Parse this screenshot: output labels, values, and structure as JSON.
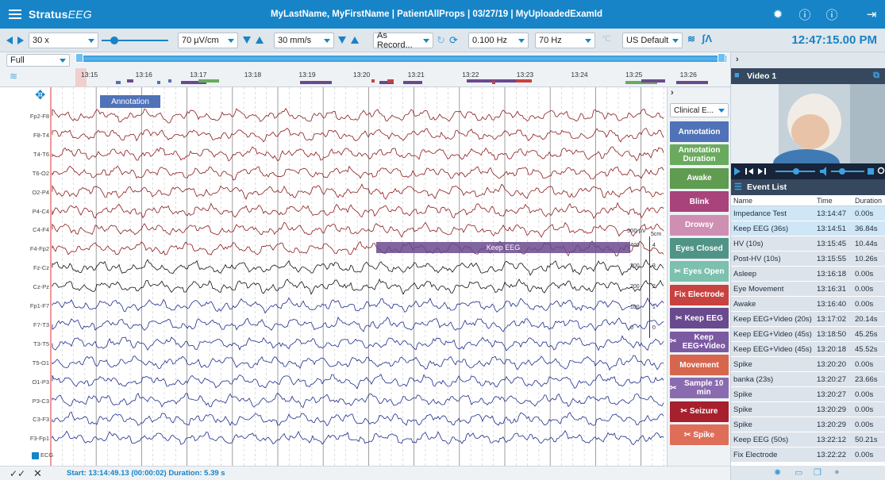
{
  "header": {
    "logo_main": "Stratus",
    "logo_accent": "EEG",
    "patient_title": "MyLastName, MyFirstName | PatientAllProps  | 03/27/19 | MyUploadedExamId"
  },
  "toolbar": {
    "speed": "30 x",
    "sensitivity": "70 µV/cm",
    "timebase": "30 mm/s",
    "montage": "As Record...",
    "low_filter": "0.100 Hz",
    "high_filter": "70 Hz",
    "notch_icon": "notch-filter-icon",
    "region": "US Default",
    "clock": "12:47:15.00 PM"
  },
  "view": {
    "mode": "Full",
    "time_ticks": [
      "13:15",
      "13:16",
      "13:17",
      "13:18",
      "13:19",
      "13:20",
      "13:21",
      "13:22",
      "13:23",
      "13:24",
      "13:25",
      "13:26"
    ]
  },
  "eeg": {
    "annotation_label": "Annotation",
    "keep_label": "Keep EEG",
    "channels": [
      "Fp2-F8",
      "F8-T4",
      "T4-T6",
      "T6-O2",
      "O2-P4",
      "P4-C4",
      "C4-F4",
      "F4-Fp2",
      "Fz-Cz",
      "Cz-Pz",
      "Fp1-F7",
      "F7-T3",
      "T3-T5",
      "T5-O1",
      "O1-P3",
      "P3-C3",
      "C3-F3",
      "F3-Fp1"
    ],
    "ecg_label": "ECG",
    "scale_uv_label": "500 µV",
    "scale_cm_label": "5cm",
    "scale_ticks": [
      "400",
      "300",
      "200",
      "100",
      "0"
    ],
    "scale_cm_ticks": [
      "4",
      "3",
      "2",
      "1",
      "0"
    ],
    "status": "Start: 13:14:49.13 (00:00:02) Duration: 5.39 s"
  },
  "events_panel": {
    "category": "Clinical E...",
    "buttons": [
      {
        "label": "Annotation",
        "color": "#4f72b8"
      },
      {
        "label": "Annotation Duration",
        "color": "#6aaa5e"
      },
      {
        "label": "Awake",
        "color": "#5f9b50"
      },
      {
        "label": "Blink",
        "color": "#a8437b"
      },
      {
        "label": "Drowsy",
        "color": "#cf8fb3"
      },
      {
        "label": "Eyes Closed",
        "color": "#4f9487"
      },
      {
        "label": "Eyes Open",
        "color": "#7cc0ae"
      },
      {
        "label": "Fix Electrode",
        "color": "#c8423f"
      },
      {
        "label": "Keep EEG",
        "color": "#6a4a8e"
      },
      {
        "label": "Keep EEG+Video",
        "color": "#7b5aa1"
      },
      {
        "label": "Movement",
        "color": "#d7664e"
      },
      {
        "label": "Sample 10 min",
        "color": "#8b6bb0"
      },
      {
        "label": "Seizure",
        "color": "#a6202d"
      },
      {
        "label": "Spike",
        "color": "#de6e58"
      }
    ]
  },
  "video": {
    "title": "Video 1"
  },
  "event_list": {
    "title": "Event List",
    "columns": [
      "Name",
      "Time",
      "Duration"
    ],
    "rows": [
      {
        "name": "Impedance Test",
        "time": "13:14:47",
        "dur": "0.00s"
      },
      {
        "name": "Keep EEG (36s)",
        "time": "13:14:51",
        "dur": "36.84s"
      },
      {
        "name": "HV (10s)",
        "time": "13:15:45",
        "dur": "10.44s"
      },
      {
        "name": "Post-HV (10s)",
        "time": "13:15:55",
        "dur": "10.26s"
      },
      {
        "name": "Asleep",
        "time": "13:16:18",
        "dur": "0.00s"
      },
      {
        "name": "Eye Movement",
        "time": "13:16:31",
        "dur": "0.00s"
      },
      {
        "name": "Awake",
        "time": "13:16:40",
        "dur": "0.00s"
      },
      {
        "name": "Keep EEG+Video (20s)",
        "time": "13:17:02",
        "dur": "20.14s"
      },
      {
        "name": "Keep EEG+Video (45s)",
        "time": "13:18:50",
        "dur": "45.25s"
      },
      {
        "name": "Keep EEG+Video (45s)",
        "time": "13:20:18",
        "dur": "45.52s"
      },
      {
        "name": "Spike",
        "time": "13:20:20",
        "dur": "0.00s"
      },
      {
        "name": "banka (23s)",
        "time": "13:20:27",
        "dur": "23.66s"
      },
      {
        "name": "Spike",
        "time": "13:20:27",
        "dur": "0.00s"
      },
      {
        "name": "Spike",
        "time": "13:20:29",
        "dur": "0.00s"
      },
      {
        "name": "Spike",
        "time": "13:20:29",
        "dur": "0.00s"
      },
      {
        "name": "Keep EEG (50s)",
        "time": "13:22:12",
        "dur": "50.21s"
      },
      {
        "name": "Fix Electrode",
        "time": "13:22:22",
        "dur": "0.00s"
      }
    ]
  },
  "colors": {
    "brand": "#1784c7",
    "trace_right": "#8b1a1a",
    "trace_mid": "#111111",
    "trace_left": "#1c2c8c",
    "row_highlight": "#cfe6f6",
    "row_normal": "#dce3ea"
  }
}
